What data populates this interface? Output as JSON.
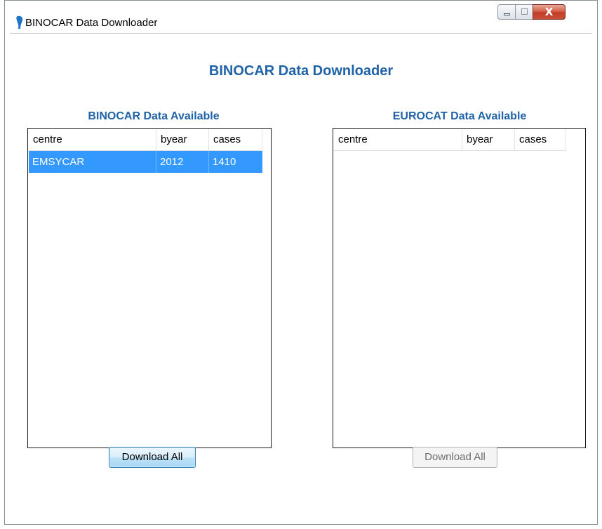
{
  "window": {
    "title": "BINOCAR Data Downloader",
    "close_glyph": "X"
  },
  "main": {
    "heading": "BINOCAR Data Downloader"
  },
  "binocar_panel": {
    "label": "BINOCAR Data Available",
    "columns": [
      "centre",
      "byear",
      "cases"
    ],
    "rows": [
      {
        "centre": "EMSYCAR",
        "byear": "2012",
        "cases": "1410",
        "selected": true
      }
    ],
    "button_label": "Download All"
  },
  "eurocat_panel": {
    "label": "EUROCAT Data Available",
    "columns": [
      "centre",
      "byear",
      "cases"
    ],
    "rows": [],
    "button_label": "Download All",
    "button_enabled": false
  },
  "colors": {
    "accent": "#2063a8",
    "selection": "#3399ff"
  }
}
